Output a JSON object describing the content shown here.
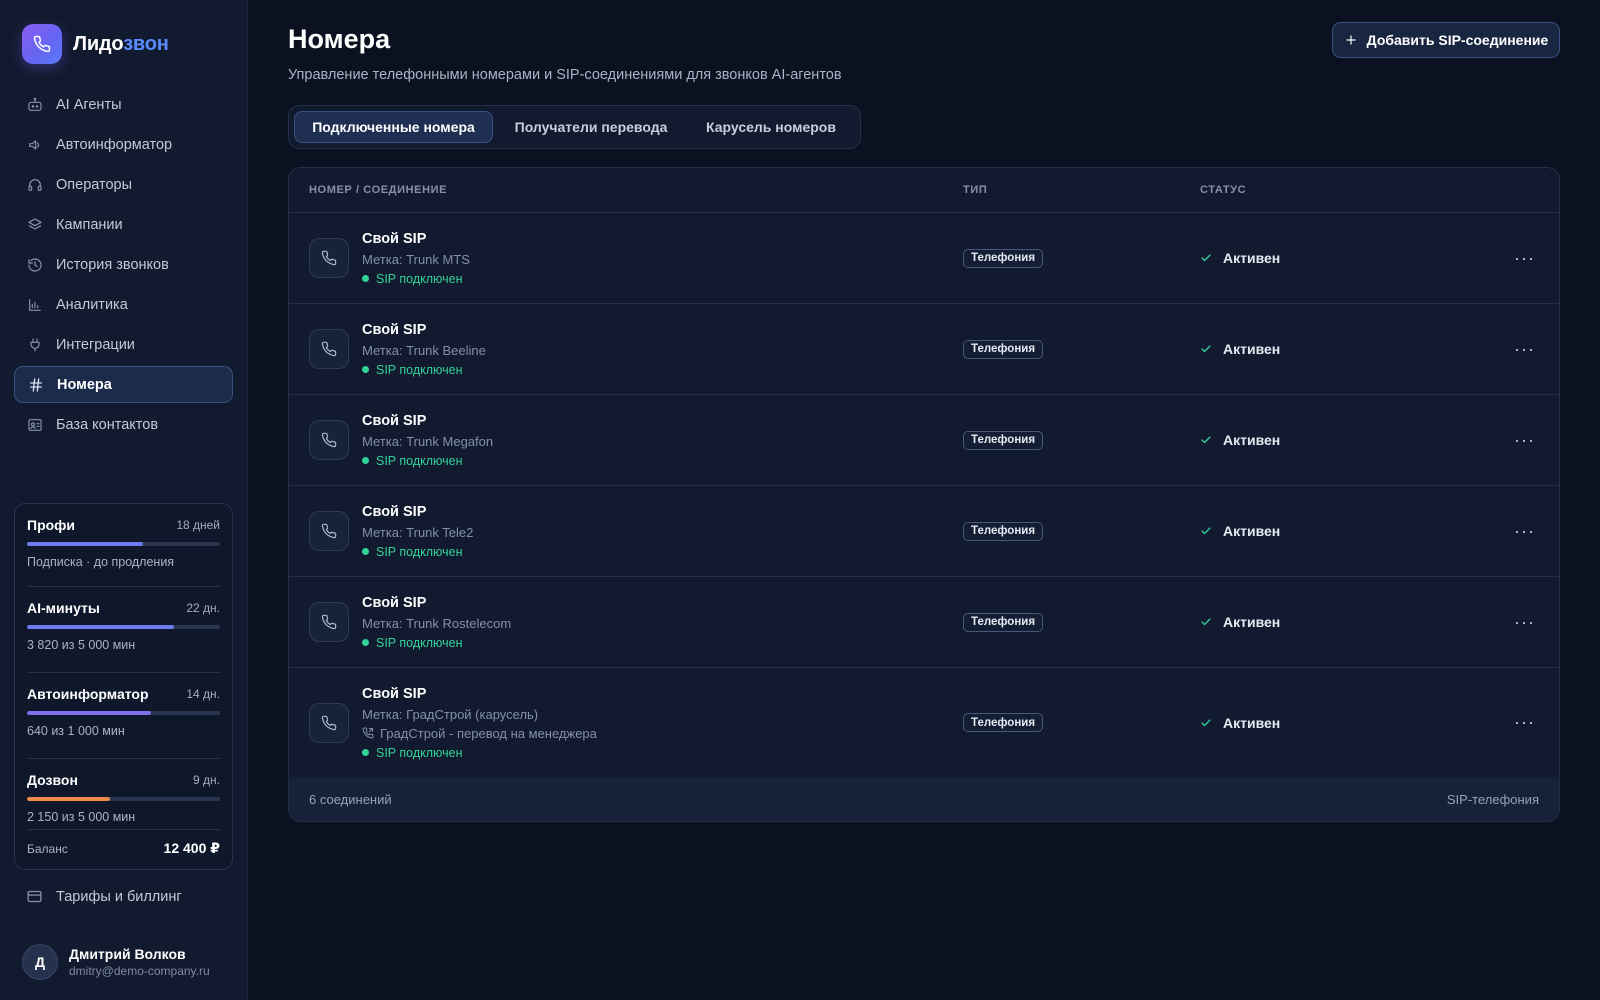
{
  "brand": {
    "name_main": "Лидо",
    "name_accent": "звон"
  },
  "nav": [
    {
      "label": "AI Агенты",
      "icon": "robot-icon"
    },
    {
      "label": "Автоинформатор",
      "icon": "speaker-icon"
    },
    {
      "label": "Операторы",
      "icon": "headset-icon"
    },
    {
      "label": "Кампании",
      "icon": "layers-icon"
    },
    {
      "label": "История звонков",
      "icon": "history-icon"
    },
    {
      "label": "Аналитика",
      "icon": "bar-chart-icon"
    },
    {
      "label": "Интеграции",
      "icon": "plug-icon"
    },
    {
      "label": "Номера",
      "icon": "hash-icon",
      "active": true
    },
    {
      "label": "База контактов",
      "icon": "contact-card-icon"
    }
  ],
  "plans": [
    {
      "name": "Профи",
      "days": "18 дней",
      "sub": "Подписка · до продления",
      "progress": 0.6,
      "color": "#6d7cf0"
    },
    {
      "name": "AI-минуты",
      "days": "22 дн.",
      "sub": "3 820 из 5 000 мин",
      "progress": 0.764,
      "color": "#6d7cf0"
    },
    {
      "name": "Автоинформатор",
      "days": "14 дн.",
      "sub": "640 из 1 000 мин",
      "progress": 0.64,
      "color": "#7f6ef0"
    },
    {
      "name": "Дозвон",
      "days": "9 дн.",
      "sub": "2 150 из 5 000 мин",
      "progress": 0.43,
      "color": "#f08a4b"
    }
  ],
  "balance": {
    "label": "Баланс",
    "value": "12 400 ₽"
  },
  "billing": {
    "label": "Тарифы и биллинг"
  },
  "user": {
    "initial": "Д",
    "name": "Дмитрий Волков",
    "email": "dmitry@demo-company.ru"
  },
  "page": {
    "title": "Номера",
    "subtitle": "Управление телефонными номерами и SIP-соединениями для звонков AI-агентов",
    "add_button": "Добавить SIP-соединение"
  },
  "tabs": [
    {
      "label": "Подключенные номера",
      "active": true
    },
    {
      "label": "Получатели перевода"
    },
    {
      "label": "Карусель номеров"
    }
  ],
  "table": {
    "headers": {
      "number": "НОМЕР / СОЕДИНЕНИЕ",
      "type": "ТИП",
      "status": "СТАТУС"
    },
    "rows": [
      {
        "title": "Свой SIP",
        "label": "Метка: Trunk MTS",
        "connection": "SIP подключен",
        "type": "Телефония",
        "status": "Активен"
      },
      {
        "title": "Свой SIP",
        "label": "Метка: Trunk Beeline",
        "connection": "SIP подключен",
        "type": "Телефония",
        "status": "Активен"
      },
      {
        "title": "Свой SIP",
        "label": "Метка: Trunk Megafon",
        "connection": "SIP подключен",
        "type": "Телефония",
        "status": "Активен"
      },
      {
        "title": "Свой SIP",
        "label": "Метка: Trunk Tele2",
        "connection": "SIP подключен",
        "type": "Телефония",
        "status": "Активен"
      },
      {
        "title": "Свой SIP",
        "label": "Метка: Trunk Rostelecom",
        "connection": "SIP подключен",
        "type": "Телефония",
        "status": "Активен"
      },
      {
        "title": "Свой SIP",
        "label": "Метка: ГрадСтрой (карусель)",
        "transfer": "ГрадСтрой - перевод на менеджера",
        "connection": "SIP подключен",
        "type": "Телефония",
        "status": "Активен"
      }
    ],
    "more_label": "···",
    "footer_count": "6 соединений",
    "footer_type": "SIP-телефония"
  }
}
